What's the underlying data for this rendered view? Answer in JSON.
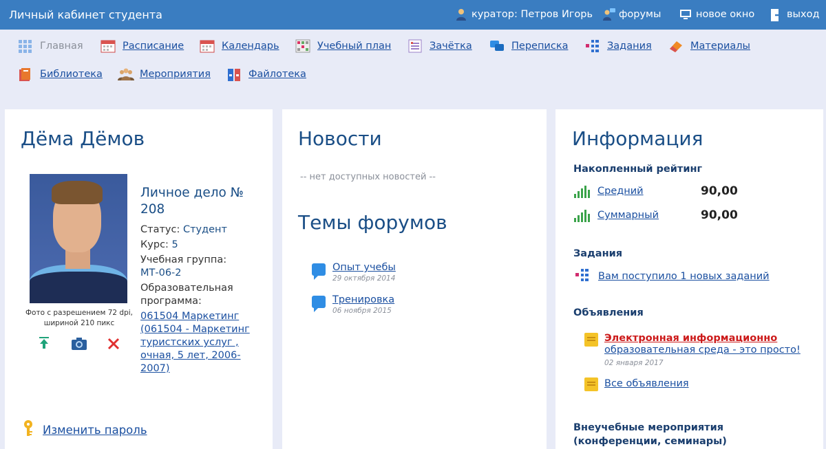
{
  "topbar": {
    "title": "Личный кабинет студента",
    "curator": "куратор: Петров Игорь",
    "forums": "форумы",
    "new_window": "новое окно",
    "logout": "выход"
  },
  "nav": {
    "items": [
      {
        "label": "Главная",
        "icon": "grid-icon"
      },
      {
        "label": "Расписание",
        "icon": "calendar-icon"
      },
      {
        "label": "Календарь",
        "icon": "calendar-icon"
      },
      {
        "label": "Учебный план",
        "icon": "grid-table-icon"
      },
      {
        "label": "Зачётка",
        "icon": "checklist-icon"
      },
      {
        "label": "Переписка",
        "icon": "chat-icon"
      },
      {
        "label": "Задания",
        "icon": "tasks-icon"
      },
      {
        "label": "Материалы",
        "icon": "eraser-icon"
      },
      {
        "label": "Библиотека",
        "icon": "books-icon"
      },
      {
        "label": "Мероприятия",
        "icon": "people-icon"
      },
      {
        "label": "Файлотека",
        "icon": "files-icon"
      }
    ]
  },
  "profile": {
    "name": "Дёма Дёмов",
    "photo_caption": "Фото с разрешением 72 dpi, шириной 210 пикс",
    "case_title": "Личное дело № 208",
    "status_label": "Статус:",
    "status_value": "Студент",
    "course_label": "Курс:",
    "course_value": "5",
    "group_label": "Учебная группа:",
    "group_value": "МТ-06-2",
    "program_label": "Образовательная программа:",
    "program_value": "061504 Маркетинг (061504 - Маркетинг туристских услуг , очная, 5 лет, 2006-2007)",
    "change_password": "Изменить пароль"
  },
  "news": {
    "title": "Новости",
    "empty": "-- нет доступных новостей --",
    "forums_title": "Темы форумов",
    "topics": [
      {
        "title": "Опыт учебы",
        "date": "29 октября 2014"
      },
      {
        "title": "Тренировка",
        "date": "06 ноября 2015"
      }
    ]
  },
  "info": {
    "title": "Информация",
    "rating_title": "Накопленный рейтинг",
    "avg_label": "Средний",
    "avg_value": "90,00",
    "sum_label": "Суммарный",
    "sum_value": "90,00",
    "tasks_title": "Задания",
    "tasks_link": "Вам поступило 1 новых заданий",
    "ann_title": "Объявления",
    "ann_headline": "Электронная информационно",
    "ann_sub": "образовательная среда - это просто!",
    "ann_date": "02 января 2017",
    "ann_all": "Все объявления",
    "extra_title": "Внеучебные мероприятия (конференции, семинары)"
  },
  "colors": {
    "topbar": "#3a7dc1",
    "background": "#e8ebf7",
    "heading": "#1a4e86",
    "link": "#1a4fa0"
  }
}
